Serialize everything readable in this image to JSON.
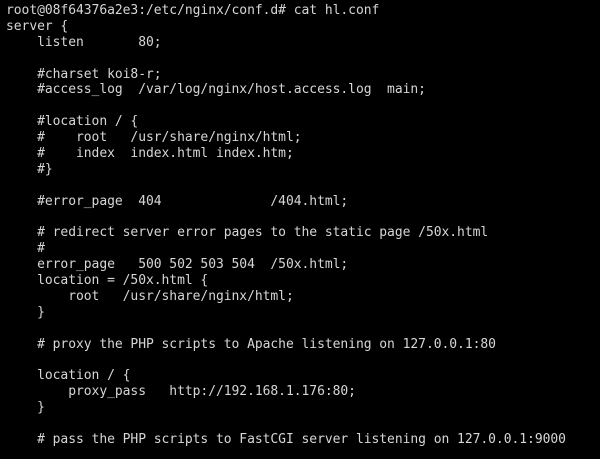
{
  "terminal": {
    "prompt": "root@08f64376a2e3:/etc/nginx/conf.d# ",
    "command": "cat hl.conf",
    "lines": [
      "server {",
      "    listen       80;",
      "",
      "    #charset koi8-r;",
      "    #access_log  /var/log/nginx/host.access.log  main;",
      "",
      "    #location / {",
      "    #    root   /usr/share/nginx/html;",
      "    #    index  index.html index.htm;",
      "    #}",
      "",
      "    #error_page  404              /404.html;",
      "",
      "    # redirect server error pages to the static page /50x.html",
      "    #",
      "    error_page   500 502 503 504  /50x.html;",
      "    location = /50x.html {",
      "        root   /usr/share/nginx/html;",
      "    }",
      "",
      "    # proxy the PHP scripts to Apache listening on 127.0.0.1:80",
      "",
      "    location / {",
      "        proxy_pass   http://192.168.1.176:80;",
      "    }",
      "",
      "    # pass the PHP scripts to FastCGI server listening on 127.0.0.1:9000"
    ]
  },
  "colors": {
    "background": "#000000",
    "foreground": "#d6d6d6"
  }
}
